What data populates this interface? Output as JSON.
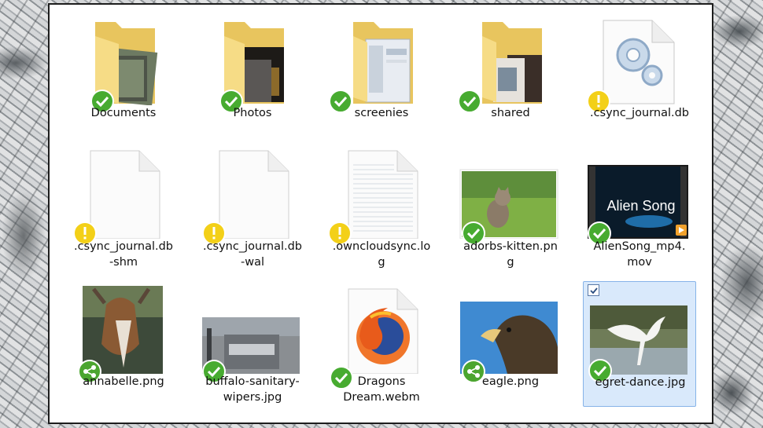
{
  "files": [
    {
      "label": "Documents",
      "kind": "folder-documents",
      "status": "synced"
    },
    {
      "label": "Photos",
      "kind": "folder-photos",
      "status": "synced"
    },
    {
      "label": "screenies",
      "kind": "folder-screenies",
      "status": "synced"
    },
    {
      "label": "shared",
      "kind": "folder-shared",
      "status": "synced"
    },
    {
      "label": ".csync_journal.db",
      "kind": "system-file",
      "status": "warning"
    },
    {
      "label": ".csync_journal.db\n-shm",
      "kind": "blank-file",
      "status": "warning"
    },
    {
      "label": ".csync_journal.db\n-wal",
      "kind": "blank-file",
      "status": "warning"
    },
    {
      "label": ".owncloudsync.lo\ng",
      "kind": "text-file",
      "status": "warning"
    },
    {
      "label": "adorbs-kitten.pn\ng",
      "kind": "image-kitten",
      "status": "synced"
    },
    {
      "label": "AlienSong_mp4.\nmov",
      "kind": "video-aliensong",
      "status": "synced",
      "thumb_text": "Alien Song"
    },
    {
      "label": "annabelle.png",
      "kind": "image-goat",
      "status": "shared"
    },
    {
      "label": "buffalo-sanitary-\nwipers.jpg",
      "kind": "image-buffalo",
      "status": "synced"
    },
    {
      "label": "Dragons\nDream.webm",
      "kind": "firefox-file",
      "status": "synced"
    },
    {
      "label": "eagle.png",
      "kind": "image-eagle",
      "status": "shared"
    },
    {
      "label": "egret-dance.jpg",
      "kind": "image-egret",
      "status": "synced",
      "selected": true
    }
  ],
  "colors": {
    "synced": "#47ab30",
    "warning": "#f3d018",
    "shared": "#4ba52f",
    "selection": "#d9e9fb"
  },
  "icons": {
    "synced": "checkmark-icon",
    "warning": "exclamation-icon",
    "shared": "share-icon"
  }
}
